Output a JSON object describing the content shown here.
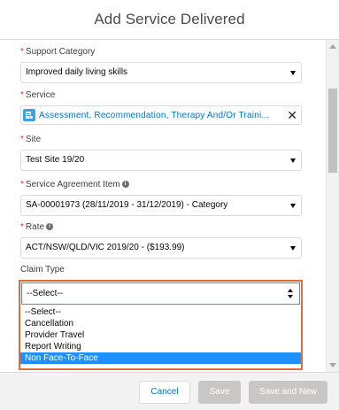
{
  "modal": {
    "title": "Add Service Delivered"
  },
  "form": {
    "support_category": {
      "label": "Support Category",
      "value": "Improved daily living skills"
    },
    "service": {
      "label": "Service",
      "value": "Assessment, Recommendation, Therapy And/Or Traini..."
    },
    "site": {
      "label": "Site",
      "value": "Test Site 19/20"
    },
    "service_agreement_item": {
      "label": "Service Agreement Item",
      "value": "SA-00001973 (28/11/2019 - 31/12/2019) - Category"
    },
    "rate": {
      "label": "Rate",
      "value": "ACT/NSW/QLD/VIC 2019/20 - ($193.99)"
    },
    "claim_type": {
      "label": "Claim Type",
      "value": "--Select--",
      "options": [
        "--Select--",
        "Cancellation",
        "Provider Travel",
        "Report Writing",
        "Non Face-To-Face"
      ],
      "highlighted": "Non Face-To-Face"
    },
    "required_marker": "*"
  },
  "footer": {
    "cancel": "Cancel",
    "save": "Save",
    "save_and_new": "Save and New"
  },
  "colors": {
    "highlight_border": "#e06c37",
    "selected_option": "#1e90ff",
    "link_blue": "#0070d2"
  },
  "icons": {
    "service_pill": "service-record-icon",
    "info": "info-icon",
    "clear": "close-icon"
  }
}
